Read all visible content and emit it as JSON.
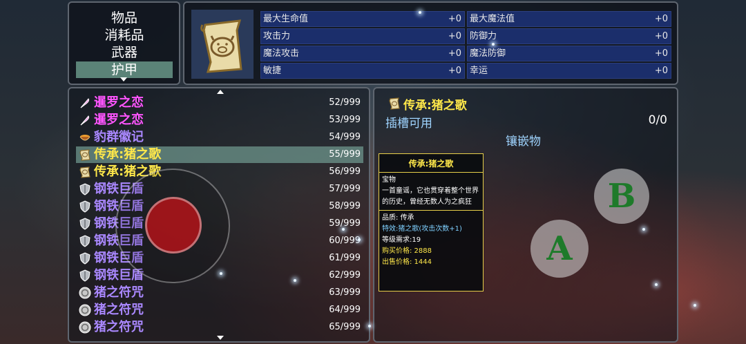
{
  "categories": {
    "items": [
      "物品",
      "消耗品",
      "武器",
      "护甲"
    ],
    "selected": "护甲"
  },
  "stats": {
    "left": [
      {
        "label": "最大生命值",
        "value": "+0"
      },
      {
        "label": "攻击力",
        "value": "+0"
      },
      {
        "label": "魔法攻击",
        "value": "+0"
      },
      {
        "label": "敏捷",
        "value": "+0"
      }
    ],
    "right": [
      {
        "label": "最大魔法值",
        "value": "+0"
      },
      {
        "label": "防御力",
        "value": "+0"
      },
      {
        "label": "魔法防御",
        "value": "+0"
      },
      {
        "label": "幸运",
        "value": "+0"
      }
    ]
  },
  "items": [
    {
      "name": "暹罗之恋",
      "qty": "52/999",
      "color": "#ff55ff",
      "icon": "feather-icon"
    },
    {
      "name": "暹罗之恋",
      "qty": "53/999",
      "color": "#ff55ff",
      "icon": "feather-icon"
    },
    {
      "name": "豹群徽记",
      "qty": "54/999",
      "color": "#aa88ff",
      "icon": "bowl-icon"
    },
    {
      "name": "传承:猪之歌",
      "qty": "55/999",
      "color": "#ffe84a",
      "icon": "scroll-icon",
      "selected": true
    },
    {
      "name": "传承:猪之歌",
      "qty": "56/999",
      "color": "#ffe84a",
      "icon": "scroll-icon"
    },
    {
      "name": "钢铁巨盾",
      "qty": "57/999",
      "color": "#aa88ff",
      "icon": "shield-icon"
    },
    {
      "name": "钢铁巨盾",
      "qty": "58/999",
      "color": "#aa88ff",
      "icon": "shield-icon"
    },
    {
      "name": "钢铁巨盾",
      "qty": "59/999",
      "color": "#aa88ff",
      "icon": "shield-icon"
    },
    {
      "name": "钢铁巨盾",
      "qty": "60/999",
      "color": "#aa88ff",
      "icon": "shield-icon"
    },
    {
      "name": "钢铁巨盾",
      "qty": "61/999",
      "color": "#aa88ff",
      "icon": "shield-icon"
    },
    {
      "name": "钢铁巨盾",
      "qty": "62/999",
      "color": "#aa88ff",
      "icon": "shield-icon"
    },
    {
      "name": "猪之符咒",
      "qty": "63/999",
      "color": "#aa88ff",
      "icon": "coin-icon"
    },
    {
      "name": "猪之符咒",
      "qty": "64/999",
      "color": "#aa88ff",
      "icon": "coin-icon"
    },
    {
      "name": "猪之符咒",
      "qty": "65/999",
      "color": "#aa88ff",
      "icon": "coin-icon"
    }
  ],
  "detail": {
    "title": "传承:猪之歌",
    "socket_label": "插槽可用",
    "socket_count": "0/0",
    "inlay_label": "镶嵌物"
  },
  "tooltip": {
    "title": "传承:猪之歌",
    "type": "宝物",
    "desc": "一首童谣，它也贯穿着整个世界的历史，曾经无数人为之疯狂",
    "quality": "品质: 传承",
    "effect": "特效:猪之歌(攻击次数+1)",
    "level_req": "等级需求:19",
    "buy_price": "购买价格: 2888",
    "sell_price": "出售价格: 1444"
  },
  "controls": {
    "button_a": "A",
    "button_b": "B"
  }
}
